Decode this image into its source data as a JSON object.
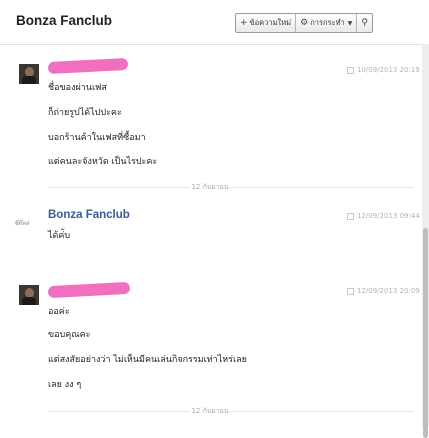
{
  "header": {
    "title": "Bonza Fanclub",
    "new_message_label": "ข้อความใหม่",
    "actions_label": "การกระทำ",
    "icons": {
      "new": "plus-icon",
      "actions": "gear-icon",
      "dropdown": "chevron-down-icon",
      "search": "search-icon"
    }
  },
  "colors": {
    "sender_name": "#3b5998",
    "redaction": "#f06fc0",
    "divider": "#a8a8a8"
  },
  "messages": [
    {
      "sender": "",
      "timestamp": "10/09/2013 20:19",
      "lines": [
        "ชื่อของผ่านเฟส",
        "ก็ถ่ายรูปได้ไปปะคะ",
        "บอกร้านค้าในเฟสที่ซื้อมา",
        "แต่คนละจังหวัด เป็นไรปะคะ"
      ]
    },
    {
      "sender": "Bonza Fanclub",
      "timestamp": "12/09/2013 09:44",
      "lines": [
        "ได้ค่ับ"
      ],
      "logo_text": "ชีดีหล่"
    },
    {
      "sender": "",
      "timestamp": "12/09/2013 20:09",
      "lines": [
        "ออค่ะ",
        "ขอบคุณคะ",
        "แต่สงสัยอย่างว่า ไม่เห็นมีคนเล่นกิจกรรมเท่าไหร่เลย",
        "เลย งง ๆ"
      ]
    }
  ],
  "dividers": [
    "12 กันยายน",
    "12 กันยายน"
  ]
}
